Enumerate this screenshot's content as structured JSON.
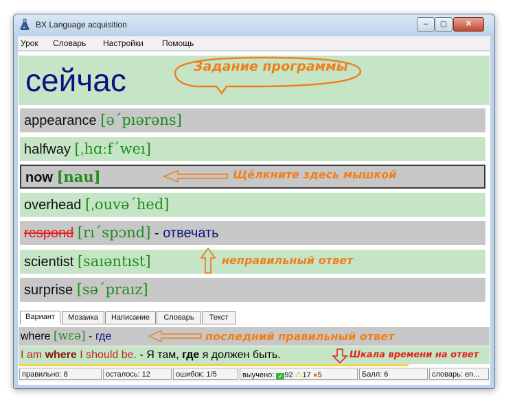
{
  "window": {
    "title": "BX Language acquisition",
    "close_glyph": "✕",
    "minimize_glyph": "–",
    "maximize_glyph": "▢"
  },
  "menu": [
    "Урок",
    "Словарь",
    "Настройки",
    "Помощь"
  ],
  "task": {
    "word": "сейчас",
    "callout": "Задание программы"
  },
  "options": [
    {
      "word": "appearance",
      "transcription": "[ə´pıərəns]",
      "style": "gray"
    },
    {
      "word": "halfway",
      "transcription": "[ˌhɑːf´weı]",
      "style": "green"
    },
    {
      "word": "now",
      "transcription": "[nau]",
      "style": "selected"
    },
    {
      "word": "overhead",
      "transcription": "[ˌouvə´hed]",
      "style": "green"
    },
    {
      "word": "respond",
      "transcription": "[rı´spɔnd]",
      "translation_prefix": " - ",
      "translation": "отвечать",
      "style": "wrong"
    },
    {
      "word": "scientist",
      "transcription": "[saıəntıst]",
      "style": "green"
    },
    {
      "word": "surprise",
      "transcription": "[sə´praız]",
      "style": "gray"
    }
  ],
  "annotations": {
    "click_here": "Щёлкните здесь мышкой",
    "wrong_answer": "неправильный ответ",
    "last_correct": "последний правильный ответ",
    "time_scale": "Шкала времени на ответ"
  },
  "tabs": [
    "Вариант",
    "Мозаика",
    "Написание",
    "Словарь",
    "Текст"
  ],
  "last_answer": {
    "word": "where",
    "transcription": "[wɛə]",
    "sep": " - ",
    "translation": "где"
  },
  "sentence": {
    "part1": "I am ",
    "bold1": "where",
    "part2": " I should be.",
    "sep": " - ",
    "ru1": "Я там, ",
    "bold2": "где",
    "ru2": " я должен быть."
  },
  "status": {
    "correct": "правильно: 8",
    "remaining": "осталось: 12",
    "errors": "ошибок: 1/5",
    "learned_label": "выучено:",
    "learned": "92",
    "warn": "17",
    "fire": "5",
    "score": "Балл: 6",
    "dictionary": "словарь: en..."
  },
  "colors": {
    "green_row": "#c6e5c6",
    "gray_row": "#c7c7c7",
    "transcription": "#1d8d1d",
    "task_word": "#0b1480",
    "annotation": "#f07f1c",
    "error_red": "#e0221c"
  }
}
